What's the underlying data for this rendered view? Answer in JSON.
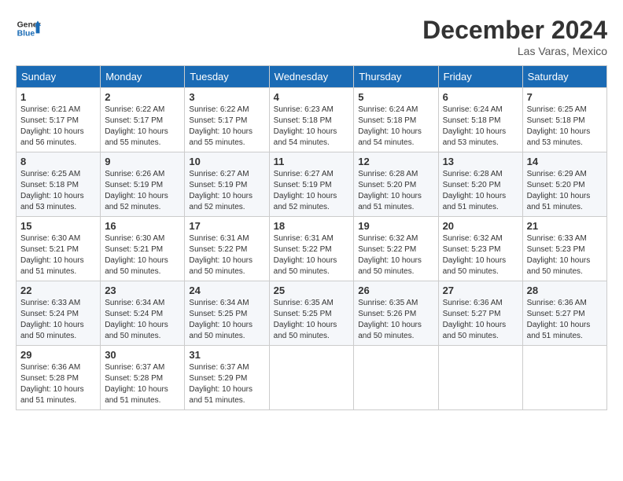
{
  "logo": {
    "text_general": "General",
    "text_blue": "Blue"
  },
  "title": "December 2024",
  "location": "Las Varas, Mexico",
  "days_of_week": [
    "Sunday",
    "Monday",
    "Tuesday",
    "Wednesday",
    "Thursday",
    "Friday",
    "Saturday"
  ],
  "weeks": [
    [
      {
        "day": "1",
        "sunrise": "6:21 AM",
        "sunset": "5:17 PM",
        "daylight": "10 hours and 56 minutes."
      },
      {
        "day": "2",
        "sunrise": "6:22 AM",
        "sunset": "5:17 PM",
        "daylight": "10 hours and 55 minutes."
      },
      {
        "day": "3",
        "sunrise": "6:22 AM",
        "sunset": "5:17 PM",
        "daylight": "10 hours and 55 minutes."
      },
      {
        "day": "4",
        "sunrise": "6:23 AM",
        "sunset": "5:18 PM",
        "daylight": "10 hours and 54 minutes."
      },
      {
        "day": "5",
        "sunrise": "6:24 AM",
        "sunset": "5:18 PM",
        "daylight": "10 hours and 54 minutes."
      },
      {
        "day": "6",
        "sunrise": "6:24 AM",
        "sunset": "5:18 PM",
        "daylight": "10 hours and 53 minutes."
      },
      {
        "day": "7",
        "sunrise": "6:25 AM",
        "sunset": "5:18 PM",
        "daylight": "10 hours and 53 minutes."
      }
    ],
    [
      {
        "day": "8",
        "sunrise": "6:25 AM",
        "sunset": "5:18 PM",
        "daylight": "10 hours and 53 minutes."
      },
      {
        "day": "9",
        "sunrise": "6:26 AM",
        "sunset": "5:19 PM",
        "daylight": "10 hours and 52 minutes."
      },
      {
        "day": "10",
        "sunrise": "6:27 AM",
        "sunset": "5:19 PM",
        "daylight": "10 hours and 52 minutes."
      },
      {
        "day": "11",
        "sunrise": "6:27 AM",
        "sunset": "5:19 PM",
        "daylight": "10 hours and 52 minutes."
      },
      {
        "day": "12",
        "sunrise": "6:28 AM",
        "sunset": "5:20 PM",
        "daylight": "10 hours and 51 minutes."
      },
      {
        "day": "13",
        "sunrise": "6:28 AM",
        "sunset": "5:20 PM",
        "daylight": "10 hours and 51 minutes."
      },
      {
        "day": "14",
        "sunrise": "6:29 AM",
        "sunset": "5:20 PM",
        "daylight": "10 hours and 51 minutes."
      }
    ],
    [
      {
        "day": "15",
        "sunrise": "6:30 AM",
        "sunset": "5:21 PM",
        "daylight": "10 hours and 51 minutes."
      },
      {
        "day": "16",
        "sunrise": "6:30 AM",
        "sunset": "5:21 PM",
        "daylight": "10 hours and 50 minutes."
      },
      {
        "day": "17",
        "sunrise": "6:31 AM",
        "sunset": "5:22 PM",
        "daylight": "10 hours and 50 minutes."
      },
      {
        "day": "18",
        "sunrise": "6:31 AM",
        "sunset": "5:22 PM",
        "daylight": "10 hours and 50 minutes."
      },
      {
        "day": "19",
        "sunrise": "6:32 AM",
        "sunset": "5:22 PM",
        "daylight": "10 hours and 50 minutes."
      },
      {
        "day": "20",
        "sunrise": "6:32 AM",
        "sunset": "5:23 PM",
        "daylight": "10 hours and 50 minutes."
      },
      {
        "day": "21",
        "sunrise": "6:33 AM",
        "sunset": "5:23 PM",
        "daylight": "10 hours and 50 minutes."
      }
    ],
    [
      {
        "day": "22",
        "sunrise": "6:33 AM",
        "sunset": "5:24 PM",
        "daylight": "10 hours and 50 minutes."
      },
      {
        "day": "23",
        "sunrise": "6:34 AM",
        "sunset": "5:24 PM",
        "daylight": "10 hours and 50 minutes."
      },
      {
        "day": "24",
        "sunrise": "6:34 AM",
        "sunset": "5:25 PM",
        "daylight": "10 hours and 50 minutes."
      },
      {
        "day": "25",
        "sunrise": "6:35 AM",
        "sunset": "5:25 PM",
        "daylight": "10 hours and 50 minutes."
      },
      {
        "day": "26",
        "sunrise": "6:35 AM",
        "sunset": "5:26 PM",
        "daylight": "10 hours and 50 minutes."
      },
      {
        "day": "27",
        "sunrise": "6:36 AM",
        "sunset": "5:27 PM",
        "daylight": "10 hours and 50 minutes."
      },
      {
        "day": "28",
        "sunrise": "6:36 AM",
        "sunset": "5:27 PM",
        "daylight": "10 hours and 51 minutes."
      }
    ],
    [
      {
        "day": "29",
        "sunrise": "6:36 AM",
        "sunset": "5:28 PM",
        "daylight": "10 hours and 51 minutes."
      },
      {
        "day": "30",
        "sunrise": "6:37 AM",
        "sunset": "5:28 PM",
        "daylight": "10 hours and 51 minutes."
      },
      {
        "day": "31",
        "sunrise": "6:37 AM",
        "sunset": "5:29 PM",
        "daylight": "10 hours and 51 minutes."
      },
      null,
      null,
      null,
      null
    ]
  ]
}
